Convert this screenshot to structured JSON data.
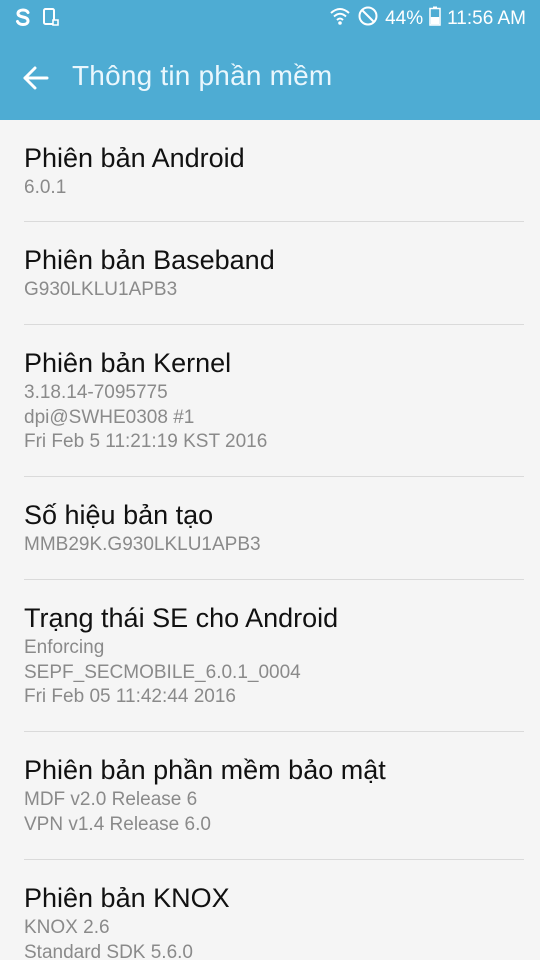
{
  "status_bar": {
    "left_icons": [
      "s-app-icon",
      "phone-rotate-icon"
    ],
    "wifi_icon": "wifi-icon",
    "blocked_icon": "no-sound-icon",
    "battery_percent": "44%",
    "battery_level": 0.44,
    "time": "11:56 AM"
  },
  "app_bar": {
    "back_icon": "arrow-left-icon",
    "title": "Thông tin phần mềm"
  },
  "colors": {
    "header_bg": "#4eacd3",
    "title_text": "#111111",
    "secondary_text": "#8a8a8a",
    "divider": "#dadada"
  },
  "items": [
    {
      "title": "Phiên bản Android",
      "lines": [
        "6.0.1"
      ]
    },
    {
      "title": "Phiên bản Baseband",
      "lines": [
        "G930LKLU1APB3"
      ]
    },
    {
      "title": "Phiên bản Kernel",
      "lines": [
        "3.18.14-7095775",
        "dpi@SWHE0308 #1",
        "Fri Feb 5 11:21:19 KST 2016"
      ]
    },
    {
      "title": "Số hiệu bản tạo",
      "lines": [
        "MMB29K.G930LKLU1APB3"
      ]
    },
    {
      "title": "Trạng thái SE cho Android",
      "lines": [
        "Enforcing",
        "SEPF_SECMOBILE_6.0.1_0004",
        "Fri Feb 05 11:42:44 2016"
      ]
    },
    {
      "title": "Phiên bản phần mềm bảo mật",
      "lines": [
        "MDF v2.0 Release 6",
        "VPN v1.4 Release 6.0"
      ]
    },
    {
      "title": "Phiên bản KNOX",
      "lines": [
        "KNOX 2.6",
        "Standard SDK 5.6.0"
      ]
    }
  ]
}
